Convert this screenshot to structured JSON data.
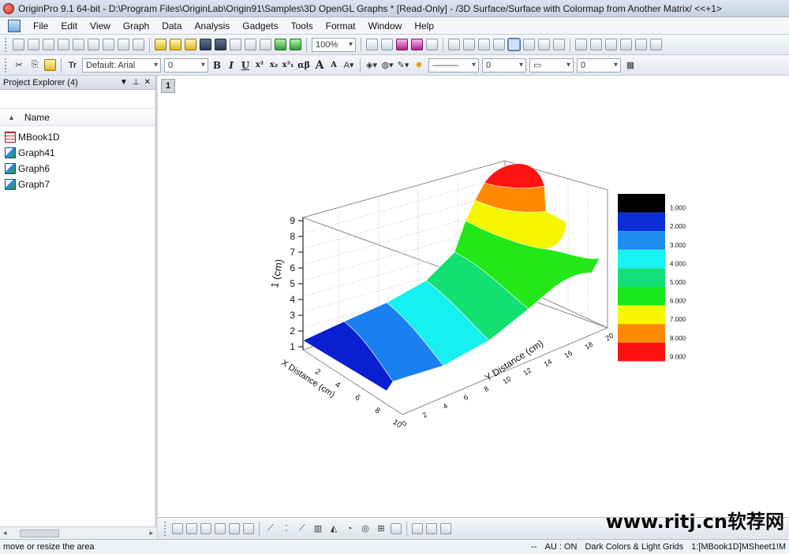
{
  "window": {
    "title": "OriginPro 9.1 64-bit - D:\\Program Files\\OriginLab\\Origin91\\Samples\\3D OpenGL Graphs * [Read-Only] - /3D Surface/Surface with Colormap from Another Matrix/ <<+1>"
  },
  "menu": [
    "File",
    "Edit",
    "View",
    "Graph",
    "Data",
    "Analysis",
    "Gadgets",
    "Tools",
    "Format",
    "Window",
    "Help"
  ],
  "toolbar": {
    "zoom": "100%",
    "font_name": "Default: Arial",
    "font_size": "0",
    "font_buttons": [
      "B",
      "I",
      "U",
      "x²",
      "x₂",
      "x²₁",
      "αβ",
      "A",
      "A"
    ],
    "line_width": "0",
    "line_style_value": "0",
    "pattern_value": "0"
  },
  "explorer": {
    "title": "Project Explorer (4)",
    "column_header": "Name",
    "items": [
      {
        "label": "MBook1D",
        "icon": "workbook-icon"
      },
      {
        "label": "Graph41",
        "icon": "graph-icon"
      },
      {
        "label": "Graph6",
        "icon": "graph-icon"
      },
      {
        "label": "Graph7",
        "icon": "graph-icon"
      }
    ]
  },
  "graph": {
    "page_number": "1",
    "z_axis_label": "1 (cm)",
    "x_axis_label": "X Distance (cm)",
    "y_axis_label": "Y Distance (cm)",
    "z_ticks": [
      "9",
      "8",
      "7",
      "6",
      "5",
      "4",
      "3",
      "2",
      "1"
    ],
    "x_ticks": [
      "2",
      "4",
      "6",
      "8",
      "10"
    ],
    "y_ticks": [
      "0",
      "2",
      "4",
      "6",
      "8",
      "10",
      "12",
      "14",
      "16",
      "18",
      "20"
    ],
    "colormap_levels": [
      "1.000",
      "2.000",
      "3.000",
      "4.000",
      "5.000",
      "6.000",
      "7.000",
      "8.000",
      "9.000"
    ],
    "colormap_colors": [
      "#000000",
      "#0a2fd6",
      "#1d8bf0",
      "#19f2f2",
      "#14e07a",
      "#19e81a",
      "#f7f700",
      "#ff8a00",
      "#ff1010"
    ],
    "surface_colors": [
      "#0a1fd0",
      "#1a7ff0",
      "#16f0f0",
      "#12e070",
      "#22e818",
      "#f5f500",
      "#ff8800",
      "#ff1212"
    ]
  },
  "statusbar": {
    "left": "move or resize the area",
    "au": "AU : ON",
    "theme": "Dark Colors & Light Grids",
    "sheet": "1:[MBook1D]MSheet1!M"
  },
  "watermark": "www.ritj.cn软荐网"
}
